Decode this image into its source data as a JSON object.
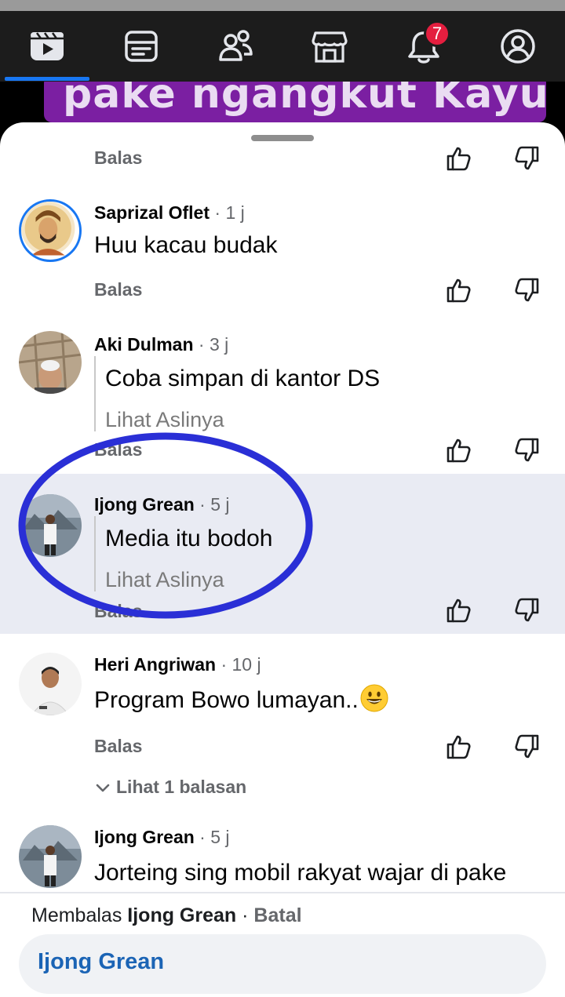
{
  "nav": {
    "items": [
      {
        "name": "video",
        "icon": "video-icon",
        "active": true
      },
      {
        "name": "feeds",
        "icon": "feeds-icon"
      },
      {
        "name": "friends",
        "icon": "friends-icon"
      },
      {
        "name": "marketplace",
        "icon": "marketplace-icon"
      },
      {
        "name": "notifications",
        "icon": "bell-icon",
        "badge": "7"
      },
      {
        "name": "profile",
        "icon": "profile-icon"
      }
    ],
    "accent": "#1877f2"
  },
  "video_banner_text": "pake ngangkut Kayu",
  "comments": [
    {
      "reply_label": "Balas"
    },
    {
      "author": "Saprizal Oflet",
      "time": "1 j",
      "text": "Huu kacau budak",
      "reply_label": "Balas"
    },
    {
      "author": "Aki Dulman",
      "time": "3 j",
      "text": "Coba simpan di kantor DS",
      "original_label": "Lihat Aslinya",
      "reply_label": "Balas"
    },
    {
      "author": "Ijong Grean",
      "time": "5 j",
      "text": "Media itu bodoh",
      "original_label": "Lihat Aslinya",
      "reply_label": "Balas",
      "highlighted": true
    },
    {
      "author": "Heri Angriwan",
      "time": "10 j",
      "text": "Program Bowo lumayan..",
      "emoji": "grinning-face",
      "reply_label": "Balas",
      "view_replies": "Lihat 1 balasan"
    },
    {
      "author": "Ijong Grean",
      "time": "5 j",
      "text": "Jorteing sing mobil rakyat wajar di pake"
    }
  ],
  "reply_bar": {
    "prefix": "Membalas",
    "target": "Ijong Grean",
    "separator": " · ",
    "cancel": "Batal",
    "input_tag": "Ijong Grean"
  },
  "colors": {
    "highlight_row": "#e9ebf3",
    "annotation_circle": "#2a2fd6",
    "notification_badge": "#e41e3f",
    "mention_text": "#1b64b5"
  }
}
